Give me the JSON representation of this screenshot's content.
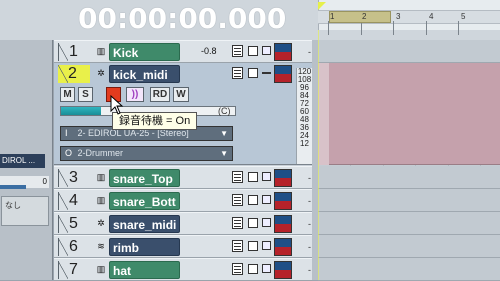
{
  "transport": {
    "time": "00:00:00.000"
  },
  "ruler": {
    "marks": [
      "1",
      "2",
      "3",
      "4",
      "5"
    ]
  },
  "left_panel": {
    "device": "DIROL ...",
    "value": "0",
    "box_text": "なし"
  },
  "tracks": [
    {
      "number": "1",
      "name": "Kick",
      "type": "audio",
      "volume": "-0.8"
    },
    {
      "number": "2",
      "name": "kick_midi",
      "type": "midi"
    },
    {
      "number": "3",
      "name": "snare_Top",
      "type": "audio"
    },
    {
      "number": "4",
      "name": "snare_Bott",
      "type": "audio"
    },
    {
      "number": "5",
      "name": "snare_midi",
      "type": "midi"
    },
    {
      "number": "6",
      "name": "rimb",
      "type": "midi"
    },
    {
      "number": "7",
      "name": "hat",
      "type": "audio"
    }
  ],
  "track2_controls": {
    "buttons": [
      "M",
      "S",
      "",
      "))",
      "RD",
      "W"
    ],
    "volume_cap": "(C)",
    "input_device": "2- EDIROL UA-25 - [Stereo]",
    "output_device": "2-Drummer",
    "input_icon": "I",
    "output_icon": "O"
  },
  "velocity_scale": [
    "120",
    "108",
    "96",
    "84",
    "72",
    "60",
    "48",
    "36",
    "24",
    "12"
  ],
  "tooltip": {
    "text": "録音待機 = On"
  },
  "colors": {
    "audio_track": "#3f8a6a",
    "midi_track": "#3a4f6c",
    "record_button": "#e23b1e",
    "selected_track_number": "#e9f04a",
    "region": "#c5a1ac"
  }
}
